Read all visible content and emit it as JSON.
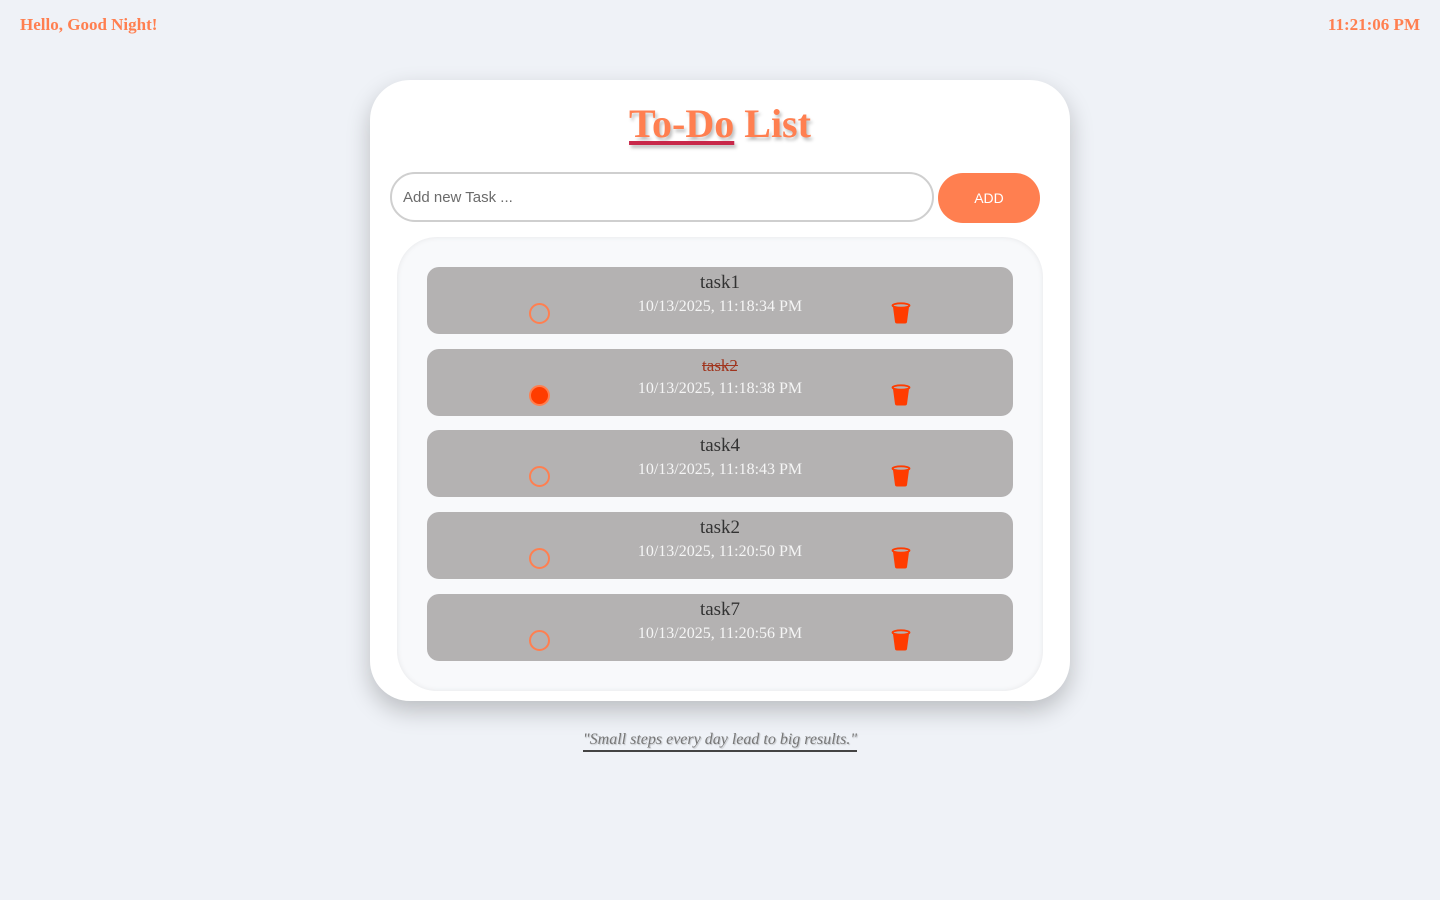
{
  "header": {
    "greeting": "Hello, Good Night!",
    "clock": "11:21:06 PM"
  },
  "title": {
    "part1": "To-Do",
    "part2": " List"
  },
  "input": {
    "placeholder": "Add new Task ...",
    "value": ""
  },
  "add_button": "ADD",
  "tasks": [
    {
      "name": "task1",
      "time": "10/13/2025, 11:18:34 PM",
      "done": false
    },
    {
      "name": "task2",
      "time": "10/13/2025, 11:18:38 PM",
      "done": true
    },
    {
      "name": "task4",
      "time": "10/13/2025, 11:18:43 PM",
      "done": false
    },
    {
      "name": "task2",
      "time": "10/13/2025, 11:20:50 PM",
      "done": false
    },
    {
      "name": "task7",
      "time": "10/13/2025, 11:20:56 PM",
      "done": false
    }
  ],
  "icons": {
    "check": "circle-check-icon",
    "delete": "trash-icon"
  },
  "colors": {
    "accent": "#ff7f50",
    "done_check": "#ff3c00",
    "trash": "#ff3c00",
    "task_bg": "#b4b2b2",
    "title_underline": "#c8284a"
  },
  "quote": "\"Small steps every day lead to big results.\""
}
